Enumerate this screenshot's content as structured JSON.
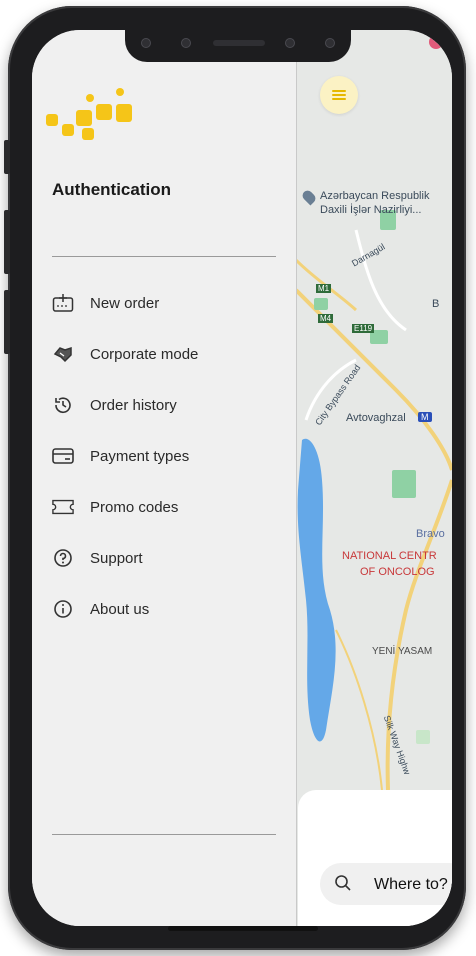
{
  "drawer": {
    "title": "Authentication",
    "items": [
      {
        "label": "New order",
        "icon": "new-order-icon"
      },
      {
        "label": "Corporate mode",
        "icon": "handshake-icon"
      },
      {
        "label": "Order history",
        "icon": "history-icon"
      },
      {
        "label": "Payment types",
        "icon": "card-icon"
      },
      {
        "label": "Promo codes",
        "icon": "ticket-icon"
      },
      {
        "label": "Support",
        "icon": "question-icon"
      },
      {
        "label": "About us",
        "icon": "info-icon"
      }
    ]
  },
  "map": {
    "labels": {
      "ministry": "Azərbaycan Respublik",
      "ministry2": "Daxili İşlər Nazirliyi...",
      "road1": "Darnagül",
      "m1": "M1",
      "m4": "M4",
      "e119": "E119",
      "bypass": "City Bypass Road",
      "bus": "Avtovaghzal",
      "metro": "M",
      "bravo": "Bravo",
      "oncology": "NATIONAL CENTR",
      "oncology2": "OF ONCOLOG",
      "yeni": "YENİ YASAM",
      "silk": "Silk Way Highw",
      "b": "B"
    },
    "search_placeholder": "Where to?"
  },
  "colors": {
    "accent": "#f5c518",
    "water": "#64a8e8",
    "road": "#f2d27a"
  }
}
